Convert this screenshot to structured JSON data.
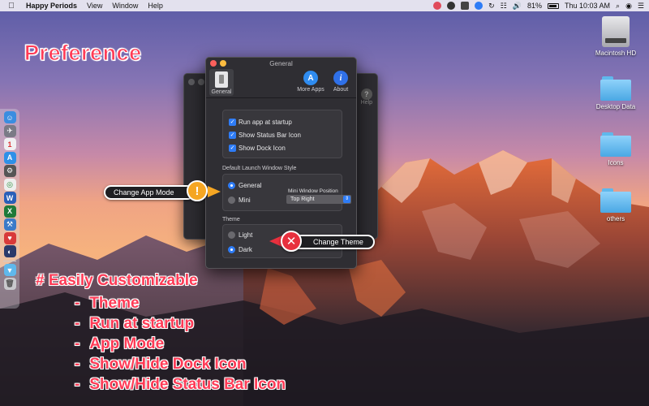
{
  "menubar": {
    "apple": "",
    "app_name": "Happy Periods",
    "menus": [
      "View",
      "Window",
      "Help"
    ],
    "battery": "81%",
    "clock": "Thu 10:03 AM"
  },
  "desktop_items": [
    {
      "label": "Macintosh HD"
    },
    {
      "label": "Desktop Data"
    },
    {
      "label": "Icons"
    },
    {
      "label": "others"
    }
  ],
  "annotations": {
    "title": "Preference",
    "features_heading": "# Easily Customizable",
    "features": [
      "Theme",
      "Run at startup",
      "App Mode",
      "Show/Hide Dock Icon",
      "Show/Hide Status Bar Icon"
    ],
    "callout_mode": "Change  App Mode",
    "callout_theme": "Change Theme"
  },
  "window": {
    "title": "General",
    "toolbar": {
      "general": "General",
      "more_apps": "More Apps",
      "about": "About",
      "help_behind": "Help"
    },
    "checkboxes": [
      {
        "label": "Run app at startup",
        "checked": true
      },
      {
        "label": "Show Status Bar Icon",
        "checked": true
      },
      {
        "label": "Show Dock Icon",
        "checked": true
      }
    ],
    "launch_style": {
      "label": "Default Launch Window Style",
      "options": [
        "General",
        "Mini"
      ],
      "selected": "General",
      "mini_position_label": "Mini Window Position",
      "mini_position_value": "Top Right"
    },
    "theme": {
      "label": "Theme",
      "options": [
        "Light",
        "Dark"
      ],
      "selected": "Dark"
    }
  },
  "colors": {
    "accent_blue": "#2e7cf6",
    "annotation_red": "#ff3b56",
    "warning_orange": "#f5a623",
    "error_red": "#e8303e"
  }
}
